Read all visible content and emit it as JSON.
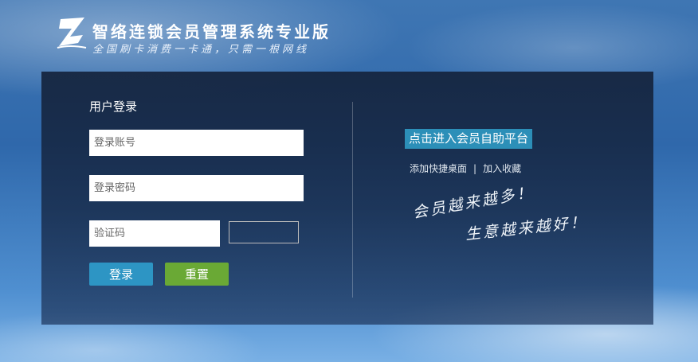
{
  "header": {
    "logo_letter": "Z",
    "title": "智络连锁会员管理系统专业版",
    "slogan": "全国刷卡消费一卡通，只需一根网线"
  },
  "login": {
    "section_title": "用户登录",
    "account_placeholder": "登录账号",
    "password_placeholder": "登录密码",
    "captcha_placeholder": "验证码",
    "login_button": "登录",
    "reset_button": "重置"
  },
  "right": {
    "member_portal_link": "点击进入会员自助平台",
    "add_shortcut": "添加快捷桌面",
    "separator": "|",
    "add_favorite": "加入收藏",
    "tagline_1": "会员越来越多！",
    "tagline_2": "生意越来越好！"
  },
  "colors": {
    "login_button": "#2d95c4",
    "reset_button": "#6aa935",
    "portal_link": "#2c8fb8"
  },
  "icons": {
    "logo": "z-logo-icon"
  }
}
